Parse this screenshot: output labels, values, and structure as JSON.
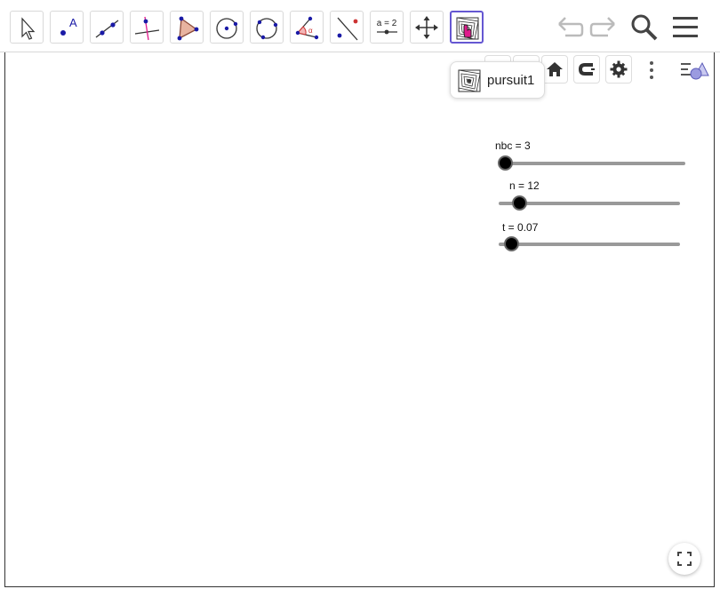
{
  "tooltip": {
    "label": "pursuit1"
  },
  "sliders": [
    {
      "label": "nbc = 3",
      "value": 3
    },
    {
      "label": "n = 12",
      "value": 12
    },
    {
      "label": "t = 0.07",
      "value": 0.07
    }
  ],
  "tool_pill": {
    "label": "a = 2"
  },
  "colors": {
    "accent": "#6557d2",
    "point": "#1a1aa6",
    "track": "#999999",
    "highlight": "#e0198c"
  },
  "icons": [
    "move-icon",
    "point-icon",
    "line-icon",
    "perpendicular-line-icon",
    "polygon-icon",
    "circle-center-point-icon",
    "circle-three-points-icon",
    "angle-icon",
    "reflect-icon",
    "slider-icon",
    "move-graphics-icon",
    "pursuit-tool-icon",
    "undo-icon",
    "redo-icon",
    "search-icon",
    "menu-icon",
    "home-icon",
    "magnet-icon",
    "gear-icon",
    "more-icon",
    "style-bar-icon",
    "fullscreen-icon"
  ]
}
